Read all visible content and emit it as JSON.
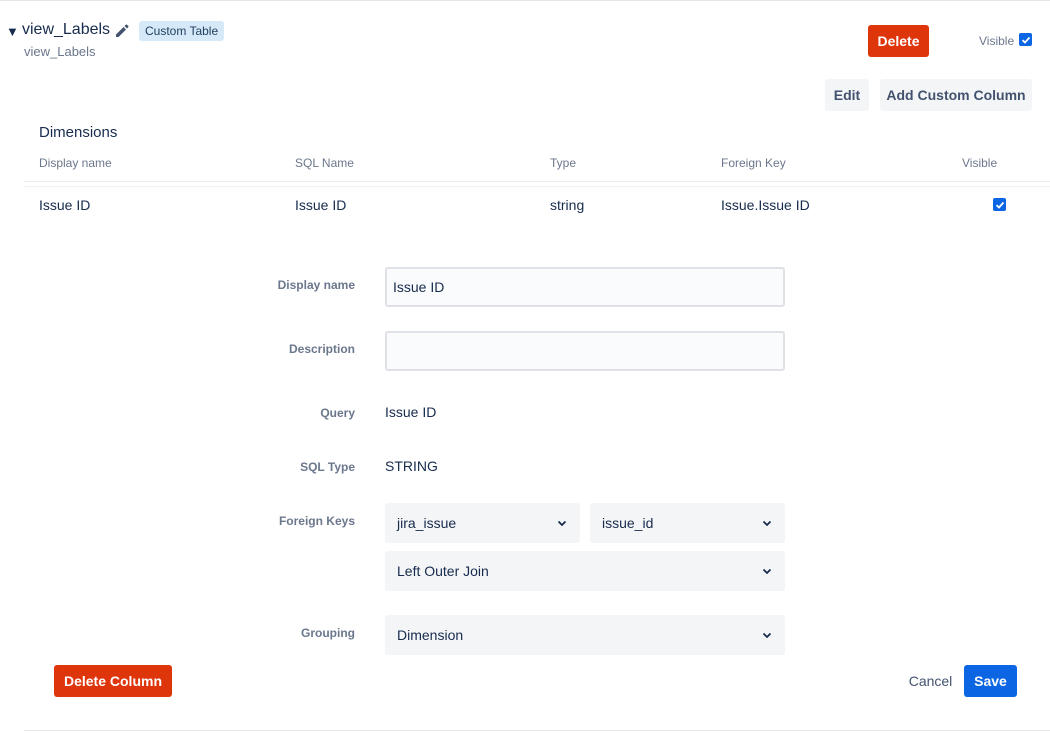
{
  "header": {
    "table_name": "view_Labels",
    "badge": "Custom Table",
    "sub_name": "view_Labels",
    "delete_label": "Delete",
    "visible_label": "Visible",
    "edit_label": "Edit",
    "add_custom_column_label": "Add Custom Column"
  },
  "dimensions": {
    "title": "Dimensions",
    "columns": [
      "Display name",
      "SQL Name",
      "Type",
      "Foreign Key",
      "Visible"
    ],
    "rows": [
      {
        "display_name": "Issue ID",
        "sql_name": "Issue ID",
        "type": "string",
        "foreign_key": "Issue.Issue ID",
        "visible": true
      }
    ]
  },
  "editor": {
    "display_name_label": "Display name",
    "display_name_value": "Issue ID",
    "description_label": "Description",
    "description_value": "",
    "query_label": "Query",
    "query_value": "Issue ID",
    "sql_type_label": "SQL Type",
    "sql_type_value": "STRING",
    "foreign_keys_label": "Foreign Keys",
    "fk_table": "jira_issue",
    "fk_column": "issue_id",
    "join_type": "Left Outer Join",
    "grouping_label": "Grouping",
    "grouping_value": "Dimension"
  },
  "footer": {
    "delete_column_label": "Delete Column",
    "cancel_label": "Cancel",
    "save_label": "Save"
  },
  "colors": {
    "danger": "#de350b",
    "primary": "#0c66e4",
    "badge_bg": "#d6e9f8"
  },
  "icons": [
    "caret-down-icon",
    "pencil-icon",
    "checkbox-checked-icon",
    "chevron-down-icon"
  ]
}
